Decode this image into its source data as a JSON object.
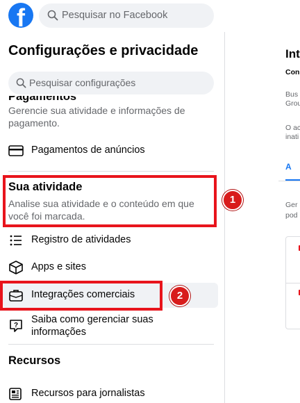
{
  "topbar": {
    "logo": "f",
    "search_placeholder": "Pesquisar no Facebook"
  },
  "panel": {
    "title": "Configurações e privacidade",
    "search_placeholder": "Pesquisar configurações"
  },
  "sections": {
    "payments": {
      "title": "Pagamentos",
      "description": "Gerencie sua atividade e informações de pagamento.",
      "items": [
        {
          "label": "Pagamentos de anúncios",
          "icon": "credit-card-icon"
        }
      ]
    },
    "activity": {
      "title": "Sua atividade",
      "description": "Analise sua atividade e o conteúdo em que você foi marcada.",
      "items": [
        {
          "label": "Registro de atividades",
          "icon": "list-icon"
        },
        {
          "label": "Apps e sites",
          "icon": "cube-icon"
        },
        {
          "label": "Integrações comerciais",
          "icon": "briefcase-icon"
        },
        {
          "label": "Saiba como gerenciar suas informações",
          "icon": "info-question-icon"
        }
      ]
    },
    "resources": {
      "title": "Recursos",
      "items": [
        {
          "label": "Recursos para jornalistas",
          "icon": "newspaper-icon"
        }
      ]
    }
  },
  "annotations": {
    "badge_1": "1",
    "badge_2": "2",
    "color": "#e8141c"
  },
  "right": {
    "title": "Int",
    "subtitle": "Con",
    "text_1a": "Bus",
    "text_1b": "Grou",
    "text_2a": "O ac",
    "text_2b": "inati",
    "tab": "A",
    "text_3a": "Ger",
    "text_3b": "pod"
  },
  "colors": {
    "brand": "#1877f2",
    "active_bg": "#f0f2f5",
    "secondary_text": "#65676b"
  }
}
